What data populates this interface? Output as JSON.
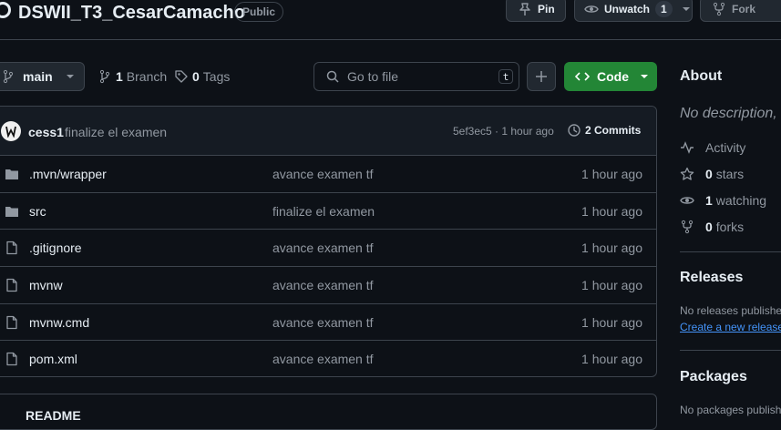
{
  "repo": {
    "name": "DSWII_T3_CesarCamacho",
    "visibility": "Public"
  },
  "header_actions": {
    "pin_label": "Pin",
    "unwatch_label": "Unwatch",
    "unwatch_count": "1",
    "fork_label": "Fork"
  },
  "toolbar": {
    "branch": "main",
    "branches_count": "1",
    "branches_label": "Branch",
    "tags_count": "0",
    "tags_label": "Tags",
    "search_placeholder": "Go to file",
    "search_shortcut": "t",
    "code_label": "Code"
  },
  "latest_commit": {
    "author": "cess1",
    "message": "finalize el examen",
    "hash_time": "5ef3ec5 · 1 hour ago",
    "commits_label": "2 Commits"
  },
  "files": [
    {
      "name": ".mvn/wrapper",
      "type": "folder",
      "message": "avance examen tf",
      "age": "1 hour ago"
    },
    {
      "name": "src",
      "type": "folder",
      "message": "finalize el examen",
      "age": "1 hour ago"
    },
    {
      "name": ".gitignore",
      "type": "file",
      "message": "avance examen tf",
      "age": "1 hour ago"
    },
    {
      "name": "mvnw",
      "type": "file",
      "message": "avance examen tf",
      "age": "1 hour ago"
    },
    {
      "name": "mvnw.cmd",
      "type": "file",
      "message": "avance examen tf",
      "age": "1 hour ago"
    },
    {
      "name": "pom.xml",
      "type": "file",
      "message": "avance examen tf",
      "age": "1 hour ago"
    }
  ],
  "readme": {
    "label": "README"
  },
  "about": {
    "heading": "About",
    "description": "No description, w",
    "activity_label": "Activity",
    "stars_count": "0",
    "stars_label": "stars",
    "watching_count": "1",
    "watching_label": "watching",
    "forks_count": "0",
    "forks_label": "forks"
  },
  "releases": {
    "heading": "Releases",
    "empty_text": "No releases publishe",
    "create_link": "Create a new release"
  },
  "packages": {
    "heading": "Packages",
    "empty_text": "No packages publish"
  },
  "colors": {
    "background": "#0d1117",
    "border": "#3d444d",
    "code_button": "#238636",
    "link": "#4493f8",
    "muted_text": "#9198a1"
  }
}
